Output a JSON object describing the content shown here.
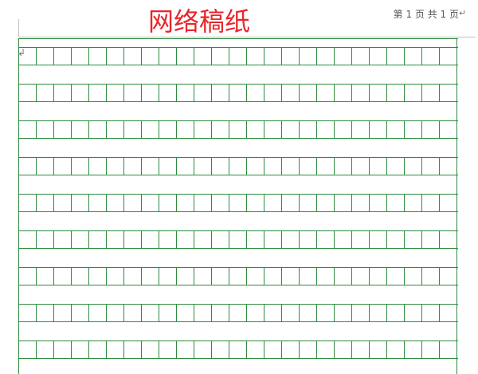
{
  "document": {
    "title": "网络稿纸",
    "page_info": "第 1 页 共 1 页",
    "return_mark": "↵",
    "cursor_mark": "↲"
  },
  "grid": {
    "columns": 25,
    "visible_rows": 9
  },
  "colors": {
    "title": "#e8262b",
    "grid_lines": "#2e8b3e",
    "page_background": "#ffffff"
  }
}
